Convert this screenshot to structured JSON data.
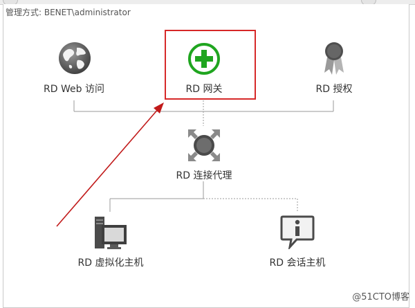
{
  "header": {
    "management_label": "管理方式: BENET\\administrator"
  },
  "nodes": {
    "rd_web": {
      "label": "RD Web 访问",
      "icon": "globe-icon"
    },
    "rd_gateway": {
      "label": "RD 网关",
      "icon": "add-circle-icon"
    },
    "rd_licensing": {
      "label": "RD 授权",
      "icon": "award-ribbon-icon"
    },
    "rd_broker": {
      "label": "RD 连接代理",
      "icon": "connection-broker-icon"
    },
    "rd_virtualization": {
      "label": "RD 虚拟化主机",
      "icon": "server-monitor-icon"
    },
    "rd_session": {
      "label": "RD 会话主机",
      "icon": "info-bubble-icon"
    }
  },
  "watermark": {
    "text": "@51CTO博客"
  },
  "colors": {
    "highlight": "#d62828",
    "gateway_accent": "#1fa51f",
    "annotation_arrow": "#c11a1a"
  }
}
